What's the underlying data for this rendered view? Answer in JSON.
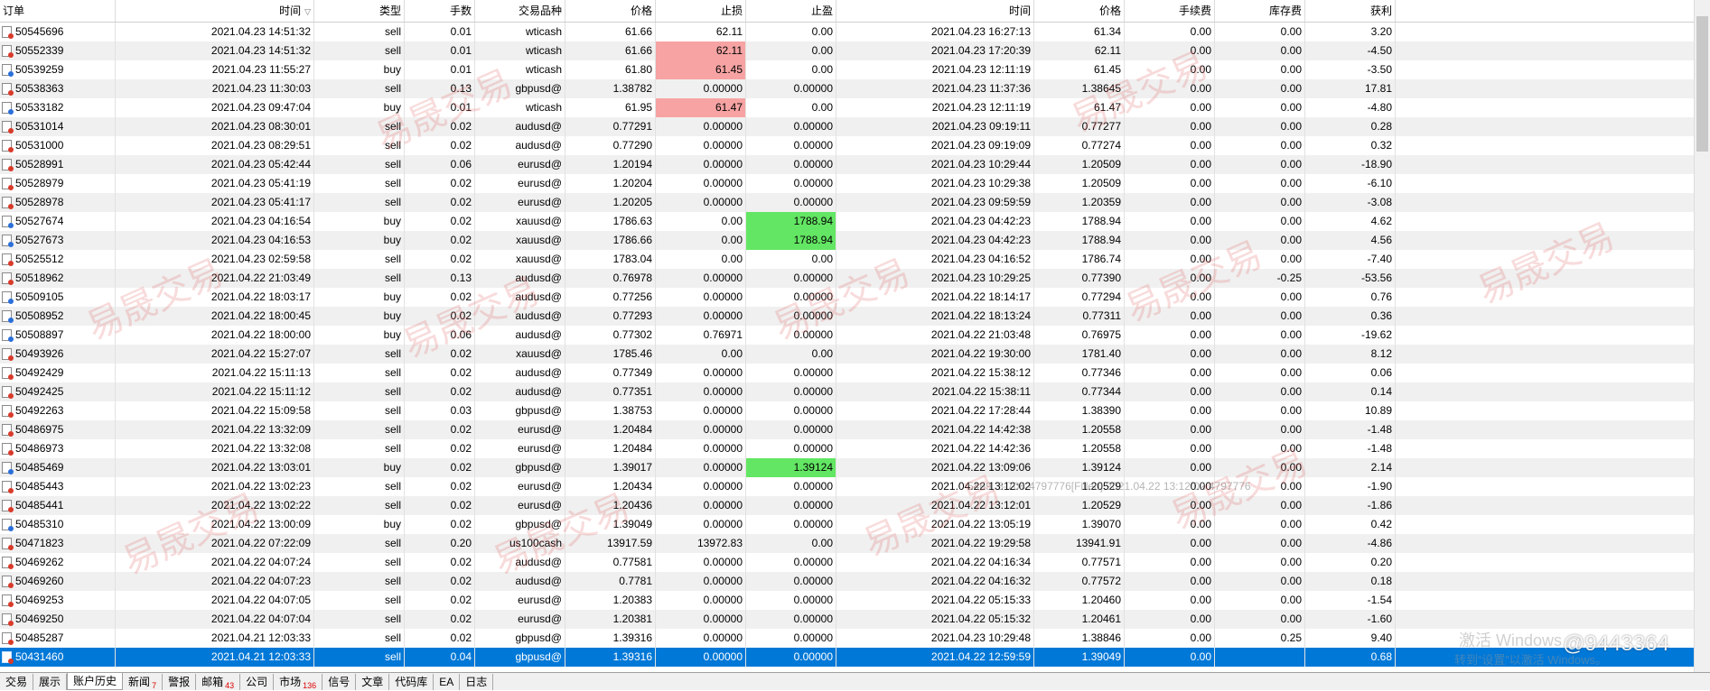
{
  "columns": [
    "订单",
    "时间",
    "类型",
    "手数",
    "交易品种",
    "价格",
    "止损",
    "止盈",
    "时间",
    "价格",
    "手续费",
    "库存费",
    "获利"
  ],
  "rows": [
    {
      "order": "50545696",
      "open_time": "2021.04.23 14:51:32",
      "type": "sell",
      "volume": "0.01",
      "symbol": "wticash",
      "open_price": "61.66",
      "sl": "62.11",
      "tp": "0.00",
      "close_time": "2021.04.23 16:27:13",
      "close_price": "61.34",
      "commission": "0.00",
      "swap": "0.00",
      "profit": "3.20"
    },
    {
      "order": "50552339",
      "open_time": "2021.04.23 14:51:32",
      "type": "sell",
      "volume": "0.01",
      "symbol": "wticash",
      "open_price": "61.66",
      "sl": "62.11",
      "tp": "0.00",
      "close_time": "2021.04.23 17:20:39",
      "close_price": "62.11",
      "commission": "0.00",
      "swap": "0.00",
      "profit": "-4.50",
      "sl_hit": true
    },
    {
      "order": "50539259",
      "open_time": "2021.04.23 11:55:27",
      "type": "buy",
      "volume": "0.01",
      "symbol": "wticash",
      "open_price": "61.80",
      "sl": "61.45",
      "tp": "0.00",
      "close_time": "2021.04.23 12:11:19",
      "close_price": "61.45",
      "commission": "0.00",
      "swap": "0.00",
      "profit": "-3.50",
      "sl_hit": true
    },
    {
      "order": "50538363",
      "open_time": "2021.04.23 11:30:03",
      "type": "sell",
      "volume": "0.13",
      "symbol": "gbpusd@",
      "open_price": "1.38782",
      "sl": "0.00000",
      "tp": "0.00000",
      "close_time": "2021.04.23 11:37:36",
      "close_price": "1.38645",
      "commission": "0.00",
      "swap": "0.00",
      "profit": "17.81"
    },
    {
      "order": "50533182",
      "open_time": "2021.04.23 09:47:04",
      "type": "buy",
      "volume": "0.01",
      "symbol": "wticash",
      "open_price": "61.95",
      "sl": "61.47",
      "tp": "0.00",
      "close_time": "2021.04.23 12:11:19",
      "close_price": "61.47",
      "commission": "0.00",
      "swap": "0.00",
      "profit": "-4.80",
      "sl_hit": true
    },
    {
      "order": "50531014",
      "open_time": "2021.04.23 08:30:01",
      "type": "sell",
      "volume": "0.02",
      "symbol": "audusd@",
      "open_price": "0.77291",
      "sl": "0.00000",
      "tp": "0.00000",
      "close_time": "2021.04.23 09:19:11",
      "close_price": "0.77277",
      "commission": "0.00",
      "swap": "0.00",
      "profit": "0.28"
    },
    {
      "order": "50531000",
      "open_time": "2021.04.23 08:29:51",
      "type": "sell",
      "volume": "0.02",
      "symbol": "audusd@",
      "open_price": "0.77290",
      "sl": "0.00000",
      "tp": "0.00000",
      "close_time": "2021.04.23 09:19:09",
      "close_price": "0.77274",
      "commission": "0.00",
      "swap": "0.00",
      "profit": "0.32"
    },
    {
      "order": "50528991",
      "open_time": "2021.04.23 05:42:44",
      "type": "sell",
      "volume": "0.06",
      "symbol": "eurusd@",
      "open_price": "1.20194",
      "sl": "0.00000",
      "tp": "0.00000",
      "close_time": "2021.04.23 10:29:44",
      "close_price": "1.20509",
      "commission": "0.00",
      "swap": "0.00",
      "profit": "-18.90"
    },
    {
      "order": "50528979",
      "open_time": "2021.04.23 05:41:19",
      "type": "sell",
      "volume": "0.02",
      "symbol": "eurusd@",
      "open_price": "1.20204",
      "sl": "0.00000",
      "tp": "0.00000",
      "close_time": "2021.04.23 10:29:38",
      "close_price": "1.20509",
      "commission": "0.00",
      "swap": "0.00",
      "profit": "-6.10"
    },
    {
      "order": "50528978",
      "open_time": "2021.04.23 05:41:17",
      "type": "sell",
      "volume": "0.02",
      "symbol": "eurusd@",
      "open_price": "1.20205",
      "sl": "0.00000",
      "tp": "0.00000",
      "close_time": "2021.04.23 09:59:59",
      "close_price": "1.20359",
      "commission": "0.00",
      "swap": "0.00",
      "profit": "-3.08"
    },
    {
      "order": "50527674",
      "open_time": "2021.04.23 04:16:54",
      "type": "buy",
      "volume": "0.02",
      "symbol": "xauusd@",
      "open_price": "1786.63",
      "sl": "0.00",
      "tp": "1788.94",
      "close_time": "2021.04.23 04:42:23",
      "close_price": "1788.94",
      "commission": "0.00",
      "swap": "0.00",
      "profit": "4.62",
      "tp_hit": true
    },
    {
      "order": "50527673",
      "open_time": "2021.04.23 04:16:53",
      "type": "buy",
      "volume": "0.02",
      "symbol": "xauusd@",
      "open_price": "1786.66",
      "sl": "0.00",
      "tp": "1788.94",
      "close_time": "2021.04.23 04:42:23",
      "close_price": "1788.94",
      "commission": "0.00",
      "swap": "0.00",
      "profit": "4.56",
      "tp_hit": true
    },
    {
      "order": "50525512",
      "open_time": "2021.04.23 02:59:58",
      "type": "sell",
      "volume": "0.02",
      "symbol": "xauusd@",
      "open_price": "1783.04",
      "sl": "0.00",
      "tp": "0.00",
      "close_time": "2021.04.23 04:16:52",
      "close_price": "1786.74",
      "commission": "0.00",
      "swap": "0.00",
      "profit": "-7.40"
    },
    {
      "order": "50518962",
      "open_time": "2021.04.22 21:03:49",
      "type": "sell",
      "volume": "0.13",
      "symbol": "audusd@",
      "open_price": "0.76978",
      "sl": "0.00000",
      "tp": "0.00000",
      "close_time": "2021.04.23 10:29:25",
      "close_price": "0.77390",
      "commission": "0.00",
      "swap": "-0.25",
      "profit": "-53.56"
    },
    {
      "order": "50509105",
      "open_time": "2021.04.22 18:03:17",
      "type": "buy",
      "volume": "0.02",
      "symbol": "audusd@",
      "open_price": "0.77256",
      "sl": "0.00000",
      "tp": "0.00000",
      "close_time": "2021.04.22 18:14:17",
      "close_price": "0.77294",
      "commission": "0.00",
      "swap": "0.00",
      "profit": "0.76"
    },
    {
      "order": "50508952",
      "open_time": "2021.04.22 18:00:45",
      "type": "buy",
      "volume": "0.02",
      "symbol": "audusd@",
      "open_price": "0.77293",
      "sl": "0.00000",
      "tp": "0.00000",
      "close_time": "2021.04.22 18:13:24",
      "close_price": "0.77311",
      "commission": "0.00",
      "swap": "0.00",
      "profit": "0.36"
    },
    {
      "order": "50508897",
      "open_time": "2021.04.22 18:00:00",
      "type": "buy",
      "volume": "0.06",
      "symbol": "audusd@",
      "open_price": "0.77302",
      "sl": "0.76971",
      "tp": "0.00000",
      "close_time": "2021.04.22 21:03:48",
      "close_price": "0.76975",
      "commission": "0.00",
      "swap": "0.00",
      "profit": "-19.62"
    },
    {
      "order": "50493926",
      "open_time": "2021.04.22 15:27:07",
      "type": "sell",
      "volume": "0.02",
      "symbol": "xauusd@",
      "open_price": "1785.46",
      "sl": "0.00",
      "tp": "0.00",
      "close_time": "2021.04.22 19:30:00",
      "close_price": "1781.40",
      "commission": "0.00",
      "swap": "0.00",
      "profit": "8.12"
    },
    {
      "order": "50492429",
      "open_time": "2021.04.22 15:11:13",
      "type": "sell",
      "volume": "0.02",
      "symbol": "audusd@",
      "open_price": "0.77349",
      "sl": "0.00000",
      "tp": "0.00000",
      "close_time": "2021.04.22 15:38:12",
      "close_price": "0.77346",
      "commission": "0.00",
      "swap": "0.00",
      "profit": "0.06"
    },
    {
      "order": "50492425",
      "open_time": "2021.04.22 15:11:12",
      "type": "sell",
      "volume": "0.02",
      "symbol": "audusd@",
      "open_price": "0.77351",
      "sl": "0.00000",
      "tp": "0.00000",
      "close_time": "2021.04.22 15:38:11",
      "close_price": "0.77344",
      "commission": "0.00",
      "swap": "0.00",
      "profit": "0.14"
    },
    {
      "order": "50492263",
      "open_time": "2021.04.22 15:09:58",
      "type": "sell",
      "volume": "0.03",
      "symbol": "gbpusd@",
      "open_price": "1.38753",
      "sl": "0.00000",
      "tp": "0.00000",
      "close_time": "2021.04.22 17:28:44",
      "close_price": "1.38390",
      "commission": "0.00",
      "swap": "0.00",
      "profit": "10.89"
    },
    {
      "order": "50486975",
      "open_time": "2021.04.22 13:32:09",
      "type": "sell",
      "volume": "0.02",
      "symbol": "eurusd@",
      "open_price": "1.20484",
      "sl": "0.00000",
      "tp": "0.00000",
      "close_time": "2021.04.22 14:42:38",
      "close_price": "1.20558",
      "commission": "0.00",
      "swap": "0.00",
      "profit": "-1.48"
    },
    {
      "order": "50486973",
      "open_time": "2021.04.22 13:32:08",
      "type": "sell",
      "volume": "0.02",
      "symbol": "eurusd@",
      "open_price": "1.20484",
      "sl": "0.00000",
      "tp": "0.00000",
      "close_time": "2021.04.22 14:42:36",
      "close_price": "1.20558",
      "commission": "0.00",
      "swap": "0.00",
      "profit": "-1.48"
    },
    {
      "order": "50485469",
      "open_time": "2021.04.22 13:03:01",
      "type": "buy",
      "volume": "0.02",
      "symbol": "gbpusd@",
      "open_price": "1.39017",
      "sl": "0.00000",
      "tp": "1.39124",
      "close_time": "2021.04.22 13:09:06",
      "close_price": "1.39124",
      "commission": "0.00",
      "swap": "0.00",
      "profit": "2.14",
      "tp_hit": true
    },
    {
      "order": "50485443",
      "open_time": "2021.04.22 13:02:23",
      "type": "sell",
      "volume": "0.02",
      "symbol": "eurusd@",
      "open_price": "1.20434",
      "sl": "0.00000",
      "tp": "0.00000",
      "close_time": "2021.04.22 13:12:02",
      "close_price": "1.20529",
      "commission": "0.00",
      "swap": "0.00",
      "profit": "-1.90"
    },
    {
      "order": "50485441",
      "open_time": "2021.04.22 13:02:22",
      "type": "sell",
      "volume": "0.02",
      "symbol": "eurusd@",
      "open_price": "1.20436",
      "sl": "0.00000",
      "tp": "0.00000",
      "close_time": "2021.04.22 13:12:01",
      "close_price": "1.20529",
      "commission": "0.00",
      "swap": "0.00",
      "profit": "-1.86"
    },
    {
      "order": "50485310",
      "open_time": "2021.04.22 13:00:09",
      "type": "buy",
      "volume": "0.02",
      "symbol": "gbpusd@",
      "open_price": "1.39049",
      "sl": "0.00000",
      "tp": "0.00000",
      "close_time": "2021.04.22 13:05:19",
      "close_price": "1.39070",
      "commission": "0.00",
      "swap": "0.00",
      "profit": "0.42"
    },
    {
      "order": "50471823",
      "open_time": "2021.04.22 07:22:09",
      "type": "sell",
      "volume": "0.20",
      "symbol": "us100cash",
      "open_price": "13917.59",
      "sl": "13972.83",
      "tp": "0.00",
      "close_time": "2021.04.22 19:29:58",
      "close_price": "13941.91",
      "commission": "0.00",
      "swap": "0.00",
      "profit": "-4.86"
    },
    {
      "order": "50469262",
      "open_time": "2021.04.22 04:07:24",
      "type": "sell",
      "volume": "0.02",
      "symbol": "audusd@",
      "open_price": "0.77581",
      "sl": "0.00000",
      "tp": "0.00000",
      "close_time": "2021.04.22 04:16:34",
      "close_price": "0.77571",
      "commission": "0.00",
      "swap": "0.00",
      "profit": "0.20"
    },
    {
      "order": "50469260",
      "open_time": "2021.04.22 04:07:23",
      "type": "sell",
      "volume": "0.02",
      "symbol": "audusd@",
      "open_price": "0.7781",
      "sl": "0.00000",
      "tp": "0.00000",
      "close_time": "2021.04.22 04:16:32",
      "close_price": "0.77572",
      "commission": "0.00",
      "swap": "0.00",
      "profit": "0.18"
    },
    {
      "order": "50469253",
      "open_time": "2021.04.22 04:07:05",
      "type": "sell",
      "volume": "0.02",
      "symbol": "eurusd@",
      "open_price": "1.20383",
      "sl": "0.00000",
      "tp": "0.00000",
      "close_time": "2021.04.22 05:15:33",
      "close_price": "1.20460",
      "commission": "0.00",
      "swap": "0.00",
      "profit": "-1.54"
    },
    {
      "order": "50469250",
      "open_time": "2021.04.22 04:07:04",
      "type": "sell",
      "volume": "0.02",
      "symbol": "eurusd@",
      "open_price": "1.20381",
      "sl": "0.00000",
      "tp": "0.00000",
      "close_time": "2021.04.22 05:15:32",
      "close_price": "1.20461",
      "commission": "0.00",
      "swap": "0.00",
      "profit": "-1.60"
    },
    {
      "order": "50485287",
      "open_time": "2021.04.21 12:03:33",
      "type": "sell",
      "volume": "0.02",
      "symbol": "gbpusd@",
      "open_price": "1.39316",
      "sl": "0.00000",
      "tp": "0.00000",
      "close_time": "2021.04.23 10:29:48",
      "close_price": "1.38846",
      "commission": "0.00",
      "swap": "0.25",
      "profit": "9.40"
    },
    {
      "order": "50431460",
      "open_time": "2021.04.21 12:03:33",
      "type": "sell",
      "volume": "0.04",
      "symbol": "gbpusd@",
      "open_price": "1.39316",
      "sl": "0.00000",
      "tp": "0.00000",
      "close_time": "2021.04.22 12:59:59",
      "close_price": "1.39049",
      "commission": "0.00",
      "swap": "",
      "profit": "0.68",
      "selected": true
    }
  ],
  "tabs": [
    {
      "label": "交易"
    },
    {
      "label": "展示"
    },
    {
      "label": "账户历史",
      "active": true
    },
    {
      "label": "新闻",
      "badge": "7"
    },
    {
      "label": "警报"
    },
    {
      "label": "邮箱",
      "badge": "43"
    },
    {
      "label": "公司"
    },
    {
      "label": "市场",
      "badge": "136"
    },
    {
      "label": "信号"
    },
    {
      "label": "文章"
    },
    {
      "label": "代码库"
    },
    {
      "label": "EA"
    },
    {
      "label": "日志"
    }
  ],
  "watermark_text": "易晟交易",
  "overlay": {
    "tooltip": "5469, 3-708-4797776[Filled] 2021.04.22 13:12:02 4797776",
    "windows_activation_title": "激活 Windows",
    "windows_activation_subtitle": "转到“设置”以激活 Windows。",
    "weibo_handle": "@9443364"
  },
  "colors": {
    "sl_hit": "#f7a3a3",
    "tp_hit": "#63e663",
    "selected_row": "#0078d7",
    "alt_row": "#f0f0f0"
  }
}
